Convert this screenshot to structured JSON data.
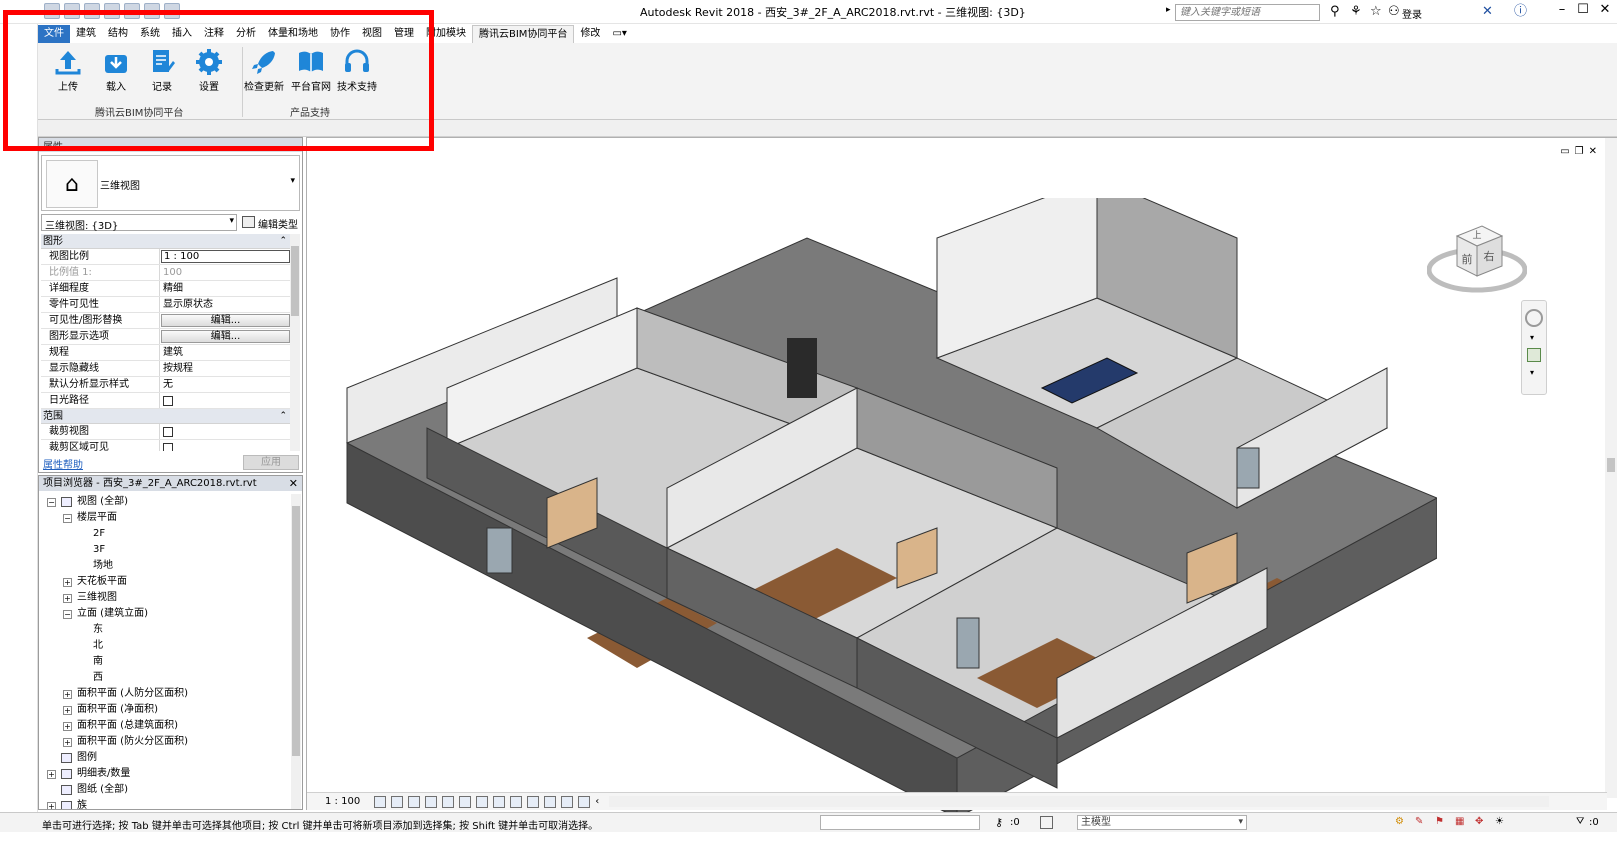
{
  "window": {
    "title": "Autodesk Revit 2018 -     西安_3#_2F_A_ARC2018.rvt.rvt - 三维视图: {3D}",
    "search_placeholder": "键入关键字或短语",
    "login_label": "登录"
  },
  "tabs": [
    {
      "label": "文件",
      "kind": "file"
    },
    {
      "label": "建筑"
    },
    {
      "label": "结构"
    },
    {
      "label": "系统"
    },
    {
      "label": "插入"
    },
    {
      "label": "注释"
    },
    {
      "label": "分析"
    },
    {
      "label": "体量和场地"
    },
    {
      "label": "协作"
    },
    {
      "label": "视图"
    },
    {
      "label": "管理"
    },
    {
      "label": "附加模块"
    },
    {
      "label": "腾讯云BIM协同平台",
      "kind": "active"
    },
    {
      "label": "修改"
    }
  ],
  "ribbon": {
    "panels": [
      {
        "label": "腾讯云BIM协同平台",
        "buttons": [
          {
            "label": "上传",
            "icon": "upload-icon"
          },
          {
            "label": "载入",
            "icon": "download-icon"
          },
          {
            "label": "记录",
            "icon": "record-icon"
          },
          {
            "label": "设置",
            "icon": "gear-icon"
          }
        ]
      },
      {
        "label": "产品支持",
        "buttons": [
          {
            "label": "检查更新",
            "icon": "rocket-icon"
          },
          {
            "label": "平台官网",
            "icon": "book-icon"
          },
          {
            "label": "技术支持",
            "icon": "headset-icon"
          }
        ]
      }
    ],
    "accent": "#1f86d8",
    "highlight_color": "#ff0000"
  },
  "properties": {
    "header": "属性",
    "type_name": "三维视图",
    "view_selector": "三维视图: {3D}",
    "edit_type_label": "编辑类型",
    "groups": [
      {
        "name": "图形",
        "rows": [
          {
            "key": "视图比例",
            "value": "1 : 100",
            "kind": "input"
          },
          {
            "key": "比例值 1:",
            "value": "100",
            "kind": "dim"
          },
          {
            "key": "详细程度",
            "value": "精细"
          },
          {
            "key": "零件可见性",
            "value": "显示原状态"
          },
          {
            "key": "可见性/图形替换",
            "value": "编辑...",
            "kind": "button"
          },
          {
            "key": "图形显示选项",
            "value": "编辑...",
            "kind": "button"
          },
          {
            "key": "规程",
            "value": "建筑"
          },
          {
            "key": "显示隐藏线",
            "value": "按规程"
          },
          {
            "key": "默认分析显示样式",
            "value": "无"
          },
          {
            "key": "日光路径",
            "value": "",
            "kind": "checkbox"
          }
        ]
      },
      {
        "name": "范围",
        "rows": [
          {
            "key": "裁剪视图",
            "value": "",
            "kind": "checkbox"
          },
          {
            "key": "裁剪区域可见",
            "value": "",
            "kind": "checkbox"
          }
        ]
      }
    ],
    "help_link": "属性帮助",
    "apply_label": "应用"
  },
  "browser": {
    "header": "项目浏览器 - 西安_3#_2F_A_ARC2018.rvt.rvt",
    "nodes": [
      {
        "label": "视图 (全部)",
        "depth": 0,
        "toggle": "−",
        "icon": "views-icon"
      },
      {
        "label": "楼层平面",
        "depth": 1,
        "toggle": "−"
      },
      {
        "label": "2F",
        "depth": 2
      },
      {
        "label": "3F",
        "depth": 2
      },
      {
        "label": "场地",
        "depth": 2
      },
      {
        "label": "天花板平面",
        "depth": 1,
        "toggle": "+"
      },
      {
        "label": "三维视图",
        "depth": 1,
        "toggle": "+"
      },
      {
        "label": "立面 (建筑立面)",
        "depth": 1,
        "toggle": "−"
      },
      {
        "label": "东",
        "depth": 2
      },
      {
        "label": "北",
        "depth": 2
      },
      {
        "label": "南",
        "depth": 2
      },
      {
        "label": "西",
        "depth": 2
      },
      {
        "label": "面积平面 (人防分区面积)",
        "depth": 1,
        "toggle": "+"
      },
      {
        "label": "面积平面 (净面积)",
        "depth": 1,
        "toggle": "+"
      },
      {
        "label": "面积平面 (总建筑面积)",
        "depth": 1,
        "toggle": "+"
      },
      {
        "label": "面积平面 (防火分区面积)",
        "depth": 1,
        "toggle": "+"
      },
      {
        "label": "图例",
        "depth": 0,
        "icon": "legend-icon"
      },
      {
        "label": "明细表/数量",
        "depth": 0,
        "toggle": "+",
        "icon": "schedule-icon"
      },
      {
        "label": "图纸 (全部)",
        "depth": 0,
        "icon": "sheet-icon"
      },
      {
        "label": "族",
        "depth": 0,
        "toggle": "+",
        "icon": "family-icon"
      }
    ]
  },
  "viewport": {
    "scale": "1 : 100",
    "viewcube_top": "上",
    "viewcube_front": "前",
    "viewcube_right": "右"
  },
  "status": {
    "message": "单击可进行选择; 按 Tab 键并单击可选择其他项目; 按 Ctrl 键并单击可将新项目添加到选择集; 按 Shift 键并单击可取消选择。",
    "zero_count": ":0",
    "model_label": "主模型",
    "filter_count": ":0"
  }
}
